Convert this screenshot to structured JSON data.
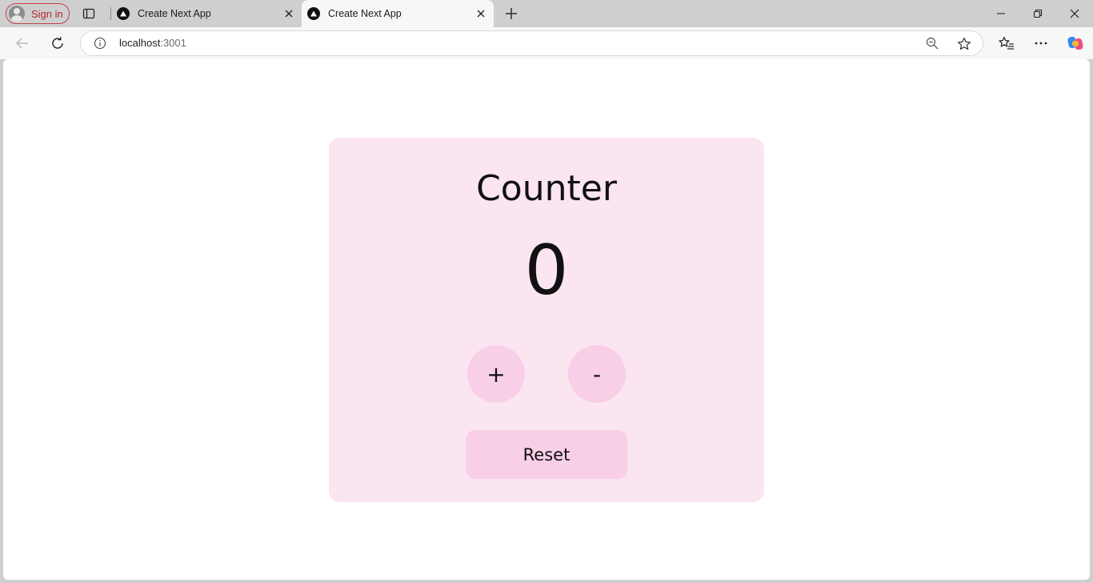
{
  "browser": {
    "profile": {
      "label": "Sign in"
    },
    "tabs": [
      {
        "title": "Create Next App",
        "active": false
      },
      {
        "title": "Create Next App",
        "active": true
      }
    ],
    "address": {
      "host": "localhost",
      "port": ":3001"
    },
    "icons": {
      "profile": "profile-avatar-icon",
      "tab_actions": "tab-actions-icon",
      "favicon": "nextjs-triangle-icon",
      "close": "close-icon",
      "new_tab": "plus-icon",
      "minimize": "minimize-icon",
      "restore": "restore-icon",
      "window_close": "close-icon",
      "back": "back-arrow-icon",
      "refresh": "refresh-icon",
      "site_info": "info-icon",
      "zoom": "zoom-out-icon",
      "favorite": "star-icon",
      "favorites": "favorites-icon",
      "menu": "more-icon",
      "copilot": "copilot-icon"
    }
  },
  "page": {
    "title": "Counter",
    "count": "0",
    "increment_label": "+",
    "decrement_label": "-",
    "reset_label": "Reset"
  },
  "colors": {
    "card_background": "#fbe5f1",
    "button_background": "#f8cfe6",
    "signin_accent": "#c0414c"
  }
}
